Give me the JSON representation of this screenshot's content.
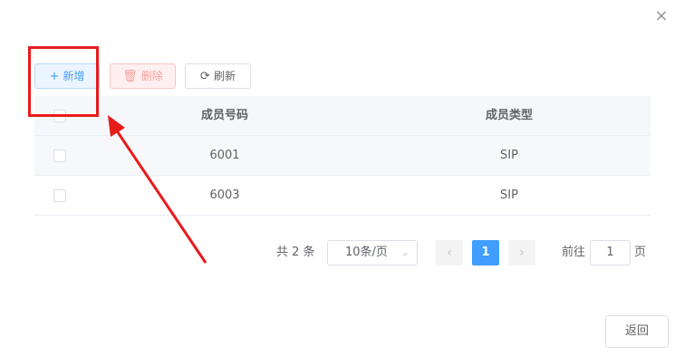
{
  "dialog": {
    "close_glyph": "×",
    "toolbar": {
      "add_icon": "plus-icon",
      "add_glyph": "+",
      "add_label": "新增",
      "delete_icon": "trash-icon",
      "delete_glyph": "🗑",
      "delete_label": "删除",
      "refresh_icon": "refresh-icon",
      "refresh_glyph": "⟳",
      "refresh_label": "刷新"
    },
    "table": {
      "columns": [
        "成员号码",
        "成员类型"
      ],
      "rows": [
        {
          "number": "6001",
          "type": "SIP"
        },
        {
          "number": "6003",
          "type": "SIP"
        }
      ]
    },
    "pagination": {
      "total_text": "共 2 条",
      "page_size": "10条/页",
      "prev_glyph": "‹",
      "next_glyph": "›",
      "current_page": "1",
      "goto_label": "前往",
      "goto_value": "1",
      "goto_suffix": "页"
    },
    "back_label": "返回"
  },
  "colors": {
    "primary": "#409eff",
    "danger_light": "#fef0f0",
    "annotation_red": "#e81b1b"
  }
}
